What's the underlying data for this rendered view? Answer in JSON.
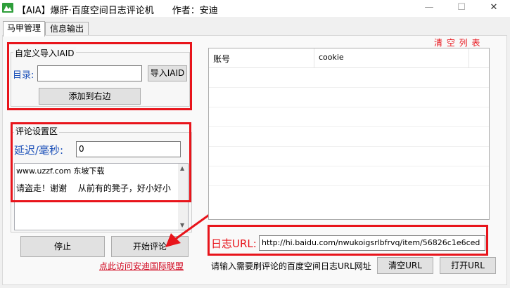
{
  "window": {
    "title": "【AIA】爆肝·百度空间日志评论机　　作者：安迪",
    "minimize_glyph": "—",
    "maximize_glyph": "☐",
    "close_glyph": "✕",
    "icon_color": "#2e9e3a"
  },
  "tabs": [
    {
      "label": "马甲管理",
      "active": true
    },
    {
      "label": "信息输出",
      "active": false
    }
  ],
  "import_group": {
    "legend": "自定义导入IAID",
    "dir_label": "目录:",
    "dir_value": "",
    "import_button": "导入IAID",
    "add_right_button": "添加到右边"
  },
  "comment_group": {
    "legend": "评论设置区",
    "delay_label": "延迟/毫秒:",
    "delay_value": "0",
    "content_line1": "www.uzzf.com 东坡下载",
    "content_line2": "请盗走！谢谢　 从前有的凳子，好小好小"
  },
  "actions": {
    "stop_button": "停止",
    "start_button": "开始评论",
    "visit_link": "点此访问安迪国际联盟"
  },
  "account_list": {
    "clear_list": "清 空 列 表",
    "columns": [
      "账号",
      "cookie"
    ]
  },
  "url_section": {
    "label": "日志URL:",
    "value": "http://hi.baidu.com/nwukoigsrlbfrvq/item/56826c1e6ced",
    "hint": "请输入需要刷评论的百度空间日志URL网址",
    "clear_button": "清空URL",
    "open_button": "打开URL"
  },
  "colors": {
    "highlight_red": "#e8141b",
    "link_red": "#d0021b",
    "label_blue": "#1a4fb8"
  }
}
